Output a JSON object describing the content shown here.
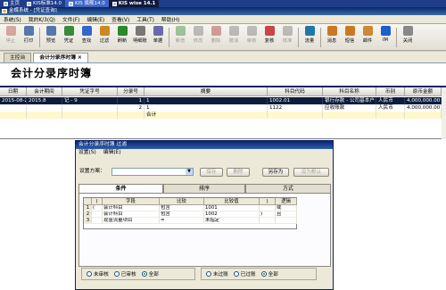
{
  "taskbar": {
    "tabs": [
      {
        "label": "主页"
      },
      {
        "label": "KIS标准14.0"
      },
      {
        "label": "KIS 旗舰14.0"
      }
    ],
    "active_tab": {
      "label": "KIS wise 14.1"
    }
  },
  "window": {
    "title": "金蝶系统 - [凭证查询]"
  },
  "menu": [
    "系统(S)",
    "我的K/3(Q)",
    "文件(F)",
    "编辑(E)",
    "查看(V)",
    "工具(T)",
    "帮助(H)"
  ],
  "toolbar": [
    {
      "label": "停止",
      "icon": "stop-icon",
      "color": "#b94a48",
      "enabled": false
    },
    {
      "label": "打印",
      "icon": "print-icon",
      "color": "#5577aa",
      "enabled": true
    },
    {
      "label": "预览",
      "icon": "preview-icon",
      "color": "#5577aa",
      "enabled": true
    },
    {
      "label": "凭证",
      "icon": "voucher-icon",
      "color": "#3a8a3a",
      "enabled": true
    },
    {
      "label": "查找",
      "icon": "find-icon",
      "color": "#3366cc",
      "enabled": true
    },
    {
      "label": "过滤",
      "icon": "filter-icon",
      "color": "#cc8a1e",
      "enabled": true
    },
    {
      "label": "刷新",
      "icon": "refresh-icon",
      "color": "#2a8a2a",
      "enabled": true
    },
    {
      "label": "明细账",
      "icon": "ledger-icon",
      "color": "#777777",
      "enabled": true
    },
    {
      "label": "单据",
      "icon": "document-icon",
      "color": "#6a6aaa",
      "enabled": true
    },
    {
      "label": "新增",
      "icon": "add-icon",
      "color": "#3a8a3a",
      "enabled": false
    },
    {
      "label": "修改",
      "icon": "edit-icon",
      "color": "#777777",
      "enabled": false
    },
    {
      "label": "删除",
      "icon": "delete-icon",
      "color": "#aa3333",
      "enabled": false
    },
    {
      "label": "撤消",
      "icon": "undo-icon",
      "color": "#777777",
      "enabled": false
    },
    {
      "label": "审核",
      "icon": "approve-icon",
      "color": "#777777",
      "enabled": false
    },
    {
      "label": "复核",
      "icon": "review-icon",
      "color": "#cc4444",
      "enabled": true
    },
    {
      "label": "核准",
      "icon": "authorize-icon",
      "color": "#777777",
      "enabled": false
    },
    {
      "label": "流量",
      "icon": "cashflow-icon",
      "color": "#2277aa",
      "enabled": true
    },
    {
      "label": "消息",
      "icon": "message-icon",
      "color": "#cc7722",
      "enabled": true
    },
    {
      "label": "短信",
      "icon": "sms-icon",
      "color": "#cc7722",
      "enabled": true
    },
    {
      "label": "邮件",
      "icon": "mail-icon",
      "color": "#cc8833",
      "enabled": true
    },
    {
      "label": "IM",
      "icon": "im-icon",
      "color": "#1e5fcc",
      "enabled": true
    },
    {
      "label": "关闭",
      "icon": "close-icon",
      "color": "#888888",
      "enabled": true
    }
  ],
  "doc_tabs": [
    {
      "label": "主控台"
    },
    {
      "label": "会计分录序时簿 ×"
    }
  ],
  "page": {
    "title": "会计分录序时簿"
  },
  "grid": {
    "columns": [
      "日期",
      "会计期间",
      "凭证字号",
      "分录号",
      "摘要",
      "科目代码",
      "科目名称",
      "币别",
      "原币金额"
    ],
    "rows": [
      [
        "2015-08-23",
        "2015.8",
        "记 - 9",
        "1",
        "1",
        "1002.01",
        "银行存款 - 公司基本户",
        "人民币",
        "4,000,000.00"
      ],
      [
        "",
        "",
        "",
        "2",
        "1",
        "1122",
        "应收账款",
        "人民币",
        "4,000,000.00"
      ],
      [
        "",
        "",
        "",
        "",
        "合计",
        "",
        "",
        "",
        ""
      ]
    ]
  },
  "dialog": {
    "title": "会计分录序时簿   过滤",
    "menu": [
      "设置(S)",
      "编辑(E)"
    ],
    "scheme_label": "设置方案：",
    "scheme_value": "",
    "buttons": {
      "save": "保存",
      "delete": "删除",
      "save_as": "另存为",
      "set_default": "设为默认"
    },
    "tabs": [
      "条件",
      "排序",
      "方式"
    ],
    "conditions": {
      "columns": [
        "(",
        "字段",
        "比较",
        "比较值",
        ")",
        "逻辑"
      ],
      "rows": [
        {
          "no": "1",
          "lparen": "(",
          "field": "会计科目",
          "op": "包含",
          "value": "1001",
          "rparen": "",
          "logic": "或"
        },
        {
          "no": "2",
          "lparen": "",
          "field": "会计科目",
          "op": "包含",
          "value": "1002",
          "rparen": ")",
          "logic": "且"
        },
        {
          "no": "3",
          "lparen": "",
          "field": "现金流量项目",
          "op": "=",
          "value": "未指定",
          "rparen": "",
          "logic": ""
        }
      ]
    },
    "audit_group": {
      "options": [
        "未审核",
        "已审核",
        "全部"
      ],
      "selected": "全部"
    },
    "posting_group": {
      "options": [
        "未过账",
        "已过账",
        "全部"
      ],
      "selected": "全部"
    }
  }
}
